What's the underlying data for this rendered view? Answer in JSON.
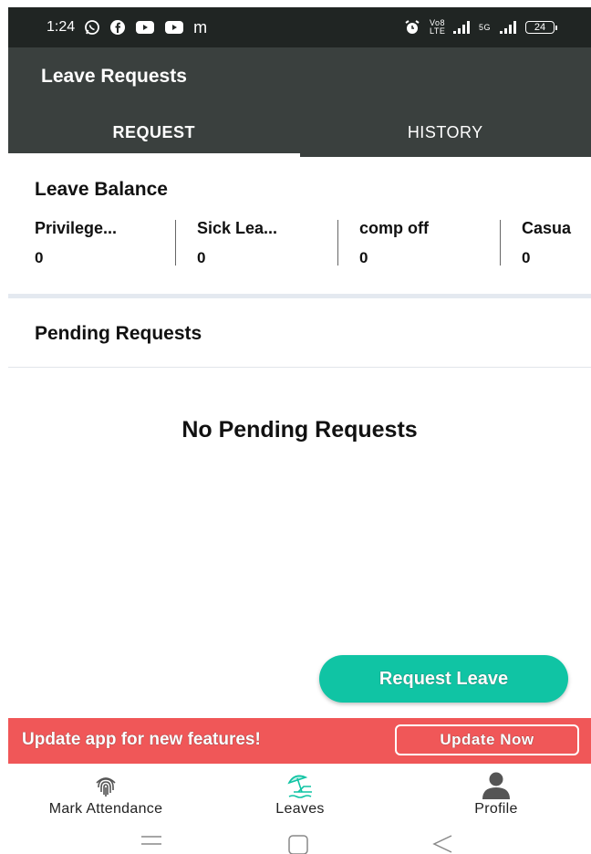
{
  "status_bar": {
    "time": "1:24",
    "left_icons": [
      "whatsapp-icon",
      "facebook-icon",
      "youtube-icon",
      "youtube-icon",
      "m-icon"
    ],
    "m_glyph": "m",
    "network_label": "Vo8 LTE",
    "signal2_label": "5G",
    "battery": "24"
  },
  "header": {
    "title": "Leave Requests",
    "tabs": [
      {
        "label": "REQUEST",
        "active": true
      },
      {
        "label": "HISTORY",
        "active": false
      }
    ]
  },
  "leave_balance": {
    "title": "Leave Balance",
    "items": [
      {
        "label": "Privilege...",
        "value": "0"
      },
      {
        "label": "Sick Lea...",
        "value": "0"
      },
      {
        "label": "comp off",
        "value": "0"
      },
      {
        "label": "Casua",
        "value": "0"
      }
    ]
  },
  "pending": {
    "title": "Pending Requests",
    "empty_message": "No Pending Requests"
  },
  "fab": {
    "label": "Request Leave",
    "color": "#10c4a4"
  },
  "update_banner": {
    "message": "Update app for new features!",
    "button_label": "Update Now",
    "color": "#f05758"
  },
  "bottom_nav": {
    "items": [
      {
        "label": "Mark Attendance",
        "icon": "fingerprint-icon"
      },
      {
        "label": "Leaves",
        "icon": "beach-umbrella-icon",
        "active": true
      },
      {
        "label": "Profile",
        "icon": "person-icon"
      }
    ]
  },
  "colors": {
    "status_bar": "#202523",
    "header": "#3a403e",
    "accent": "#10c4a4",
    "banner": "#f05758"
  }
}
